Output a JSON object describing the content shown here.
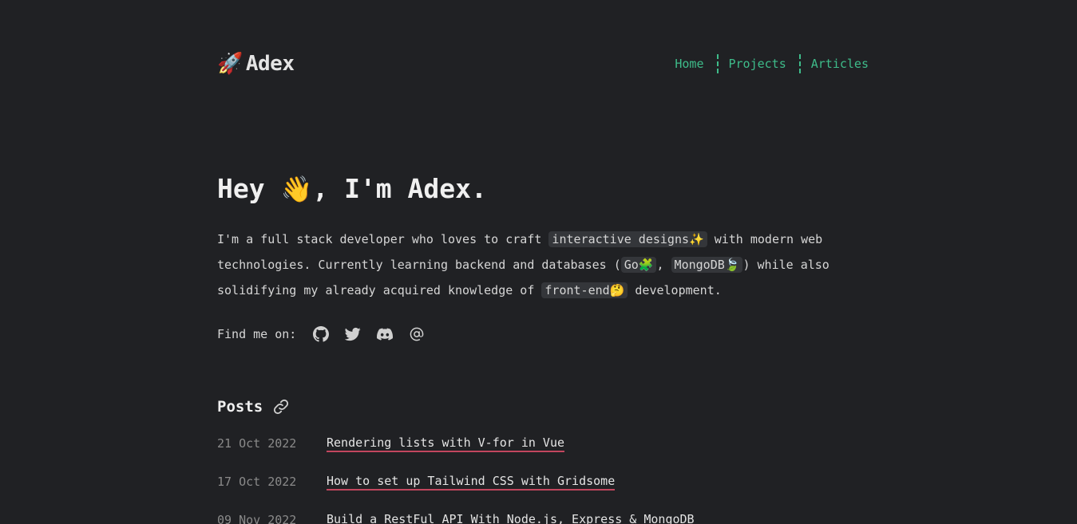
{
  "header": {
    "brand_emoji": "🚀",
    "brand_name": "Adex",
    "nav": [
      {
        "label": "Home"
      },
      {
        "label": "Projects"
      },
      {
        "label": "Articles"
      }
    ]
  },
  "hero": {
    "greeting_pre": "Hey ",
    "wave_emoji": "👋",
    "greeting_post": ", I'm Adex.",
    "intro": {
      "p1": "I'm a full stack developer who loves to craft ",
      "chip1": "interactive designs✨",
      "p2": " with modern web technologies. Currently learning backend and databases (",
      "chip2": "Go🧩",
      "p3": ", ",
      "chip3": "MongoDB🍃",
      "p4": ") while also solidifying my already acquired knowledge of ",
      "chip4": "front-end🤔",
      "p5": " development."
    },
    "find_me_label": "Find me on:",
    "socials": [
      {
        "icon": "github-icon"
      },
      {
        "icon": "twitter-icon"
      },
      {
        "icon": "discord-icon"
      },
      {
        "icon": "email-at-icon"
      }
    ]
  },
  "posts": {
    "title": "Posts",
    "items": [
      {
        "date": "21 Oct 2022",
        "title": "Rendering lists with V-for in Vue"
      },
      {
        "date": "17 Oct 2022",
        "title": "How to set up Tailwind CSS with Gridsome"
      },
      {
        "date": "09 Nov 2022",
        "title": "Build a RestFul API With Node.js, Express & MongoDB"
      }
    ]
  },
  "colors": {
    "background": "#202124",
    "accent_green": "#3ebc8a",
    "underline_red": "#c2465e",
    "chip_bg": "#34363a",
    "date_gray": "#8a8a8a"
  }
}
